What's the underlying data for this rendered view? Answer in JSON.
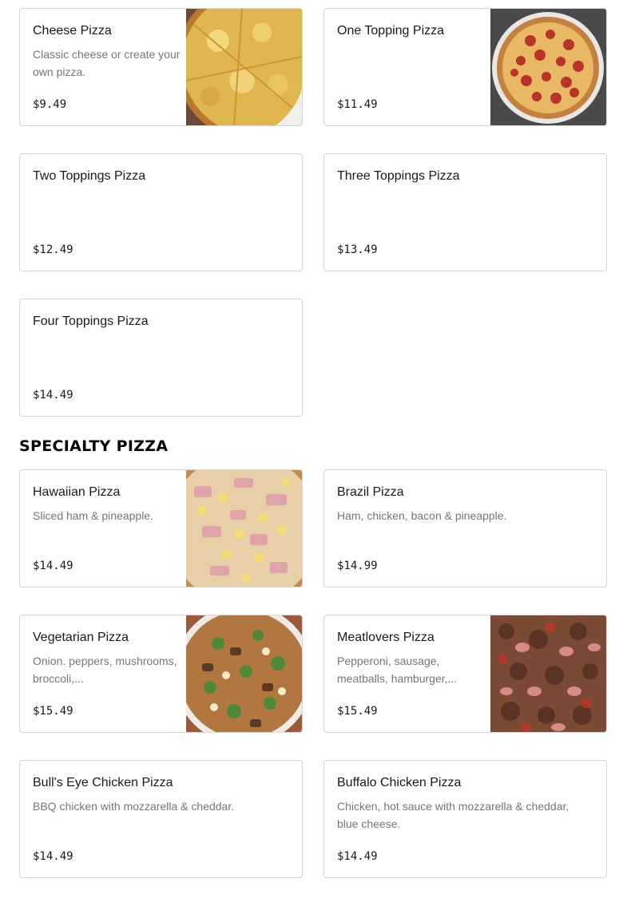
{
  "menu": {
    "items": [
      {
        "title": "Cheese Pizza",
        "description": "Classic cheese or create your own pizza.",
        "price": "$9.49",
        "image": "cheese-pizza-photo"
      },
      {
        "title": "One Topping Pizza",
        "description": "",
        "price": "$11.49",
        "image": "pepperoni-pizza-photo"
      },
      {
        "title": "Two Toppings Pizza",
        "description": "",
        "price": "$12.49"
      },
      {
        "title": "Three Toppings Pizza",
        "description": "",
        "price": "$13.49"
      },
      {
        "title": "Four Toppings Pizza",
        "description": "",
        "price": "$14.49"
      }
    ]
  },
  "specialty": {
    "heading": "SPECIALTY PIZZA",
    "items": [
      {
        "title": "Hawaiian Pizza",
        "description": "Sliced ham & pineapple.",
        "price": "$14.49",
        "image": "hawaiian-pizza-photo"
      },
      {
        "title": "Brazil Pizza",
        "description": "Ham, chicken, bacon & pineapple.",
        "price": "$14.99"
      },
      {
        "title": "Vegetarian Pizza",
        "description": "Onion. peppers, mushrooms, broccoli,...",
        "price": "$15.49",
        "image": "vegetarian-pizza-photo"
      },
      {
        "title": "Meatlovers Pizza",
        "description": "Pepperoni, sausage, meatballs, hamburger,...",
        "price": "$15.49",
        "image": "meatlovers-pizza-photo"
      },
      {
        "title": "Bull's Eye Chicken Pizza",
        "description": "BBQ chicken with mozzarella & cheddar.",
        "price": "$14.49"
      },
      {
        "title": "Buffalo Chicken Pizza",
        "description": "Chicken, hot sauce with mozzarella & cheddar, blue cheese.",
        "price": "$14.49"
      }
    ]
  }
}
